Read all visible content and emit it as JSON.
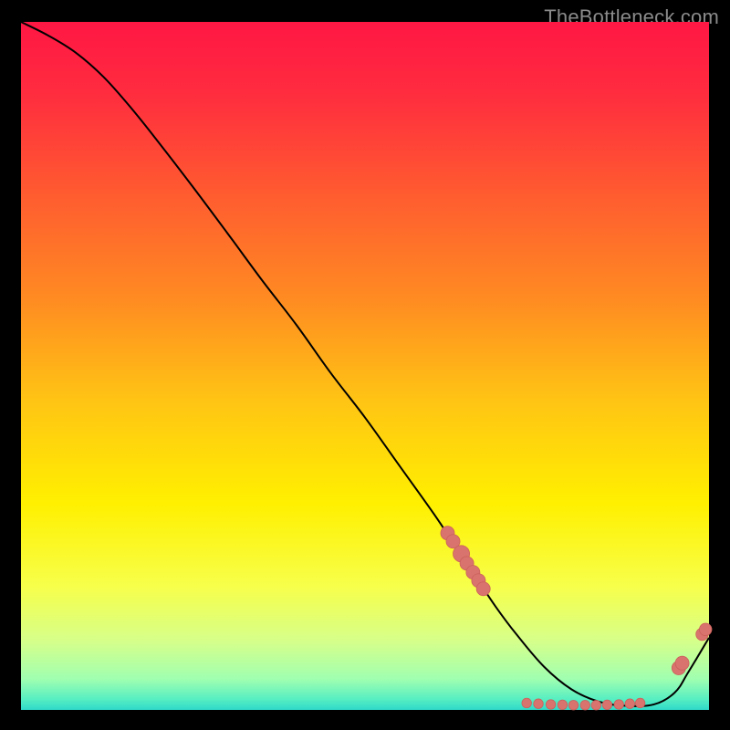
{
  "attribution": "TheBottleneck.com",
  "colors": {
    "background": "#000000",
    "attribution_text": "#8a8a8a",
    "line": "#000000",
    "marker_fill": "#d8736e",
    "marker_stroke": "#cc5f5a"
  },
  "gradient_stops": [
    {
      "offset": 0.0,
      "color": "#ff1744"
    },
    {
      "offset": 0.1,
      "color": "#ff2b3f"
    },
    {
      "offset": 0.25,
      "color": "#ff5b30"
    },
    {
      "offset": 0.4,
      "color": "#ff8a22"
    },
    {
      "offset": 0.55,
      "color": "#ffc414"
    },
    {
      "offset": 0.7,
      "color": "#fff000"
    },
    {
      "offset": 0.82,
      "color": "#f7ff4a"
    },
    {
      "offset": 0.9,
      "color": "#d6ff8a"
    },
    {
      "offset": 0.955,
      "color": "#a0ffb0"
    },
    {
      "offset": 0.985,
      "color": "#55eec2"
    },
    {
      "offset": 1.0,
      "color": "#2fd8c8"
    }
  ],
  "chart_data": {
    "type": "line",
    "title": "",
    "xlabel": "",
    "ylabel": "",
    "xlim": [
      0,
      100
    ],
    "ylim": [
      0,
      100
    ],
    "grid": false,
    "legend": false,
    "series": [
      {
        "name": "curve",
        "x": [
          0,
          4,
          8,
          12,
          16,
          20,
          25,
          30,
          35,
          40,
          45,
          50,
          55,
          60,
          63,
          66,
          69,
          72,
          76,
          80,
          84,
          88,
          92,
          95,
          97,
          100
        ],
        "y": [
          100,
          98,
          95.5,
          92,
          87.5,
          82.5,
          76,
          69.3,
          62.5,
          56,
          49,
          42.5,
          35.5,
          28.5,
          24,
          19.5,
          15,
          11,
          6.3,
          3.0,
          1.2,
          0.6,
          0.8,
          2.5,
          5.5,
          10.5
        ]
      }
    ],
    "markers": [
      {
        "x": 62.0,
        "y": 25.7,
        "r": 1.0
      },
      {
        "x": 62.8,
        "y": 24.5,
        "r": 1.0
      },
      {
        "x": 64.0,
        "y": 22.7,
        "r": 1.2
      },
      {
        "x": 64.8,
        "y": 21.3,
        "r": 1.0
      },
      {
        "x": 65.7,
        "y": 20.0,
        "r": 1.0
      },
      {
        "x": 66.5,
        "y": 18.8,
        "r": 1.0
      },
      {
        "x": 67.2,
        "y": 17.6,
        "r": 1.0
      },
      {
        "x": 73.5,
        "y": 1.0,
        "r": 0.7
      },
      {
        "x": 75.2,
        "y": 0.9,
        "r": 0.7
      },
      {
        "x": 77.0,
        "y": 0.8,
        "r": 0.7
      },
      {
        "x": 78.7,
        "y": 0.75,
        "r": 0.7
      },
      {
        "x": 80.3,
        "y": 0.7,
        "r": 0.7
      },
      {
        "x": 82.0,
        "y": 0.7,
        "r": 0.7
      },
      {
        "x": 83.6,
        "y": 0.7,
        "r": 0.7
      },
      {
        "x": 85.2,
        "y": 0.75,
        "r": 0.7
      },
      {
        "x": 86.9,
        "y": 0.8,
        "r": 0.7
      },
      {
        "x": 88.5,
        "y": 0.9,
        "r": 0.7
      },
      {
        "x": 90.0,
        "y": 1.0,
        "r": 0.7
      },
      {
        "x": 95.6,
        "y": 6.1,
        "r": 1.0
      },
      {
        "x": 96.1,
        "y": 6.8,
        "r": 1.0
      },
      {
        "x": 99.0,
        "y": 11.0,
        "r": 0.9
      },
      {
        "x": 99.5,
        "y": 11.7,
        "r": 0.9
      }
    ]
  }
}
